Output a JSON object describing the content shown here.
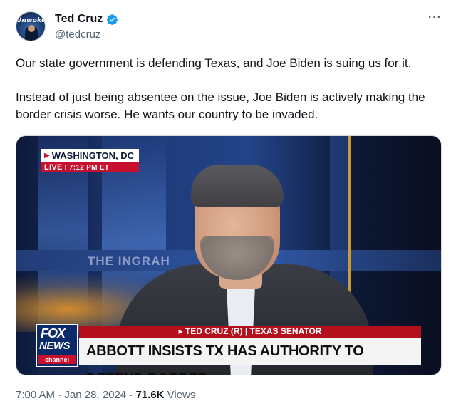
{
  "tweet": {
    "author": {
      "display_name": "Ted Cruz",
      "handle": "@tedcruz",
      "avatar_text": "Unwoke",
      "verified": true
    },
    "more_icon": "more-horizontal-icon",
    "more_label": "···",
    "text": [
      "Our state government is defending Texas, and Joe Biden is suing us for it.",
      "Instead of just being absentee on the issue, Joe Biden is actively making the border crisis worse. He wants our country to be invaded."
    ],
    "media": {
      "location": "WASHINGTON, DC",
      "live_label": "LIVE",
      "live_time": "7:12 PM ET",
      "studio_text": "THE INGRAH",
      "network_top": "FOX",
      "network_bottom": "NEWS",
      "network_sub": "channel",
      "chyron_name": "▸ TED CRUZ (R) | TEXAS SENATOR",
      "chyron_headline": "ABBOTT INSISTS TX HAS AUTHORITY TO DEFEND BORDER"
    },
    "meta": {
      "time": "7:00 AM",
      "separator": " · ",
      "date": "Jan 28, 2024",
      "views_count": "71.6K",
      "views_label": " Views"
    },
    "colors": {
      "verified": "#1d9bf0",
      "text": "#0f1419",
      "secondary": "#536471",
      "fox_red": "#c8102e",
      "fox_blue": "#0a2a6b"
    }
  }
}
